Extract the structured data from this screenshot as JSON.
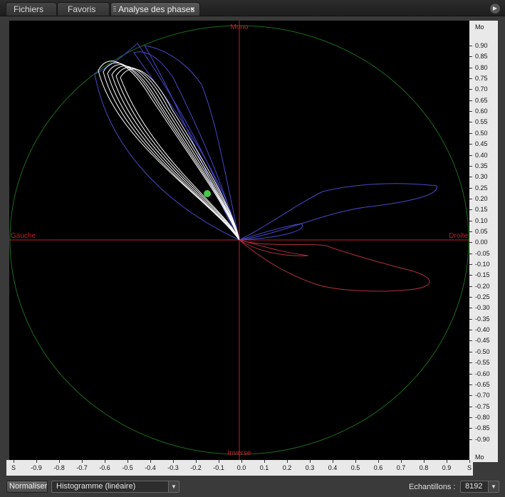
{
  "tabs": [
    {
      "label": "Fichiers"
    },
    {
      "label": "Favoris"
    },
    {
      "label": "Analyse des phases",
      "close": "×"
    }
  ],
  "panel_menu_icon": "play-circle-icon",
  "plot": {
    "top_label": "Mono",
    "bottom_label": "Inverse",
    "left_label": "Gauche",
    "right_label": "Droite",
    "colors": {
      "grid_circle": "#1b6b1b",
      "axes": "#c0202a",
      "left_trace": "#ffffff",
      "left_outer": "#4848c8",
      "right_trace": "#b03040",
      "marker": "#44cc44"
    }
  },
  "right_axis": {
    "top": "Mo",
    "bottom": "Mo",
    "labels": [
      "0.90",
      "0.85",
      "0.80",
      "0.75",
      "0.70",
      "0.65",
      "0.60",
      "0.55",
      "0.50",
      "0.45",
      "0.40",
      "0.35",
      "0.30",
      "0.25",
      "0.20",
      "0.15",
      "0.10",
      "0.05",
      "0.00",
      "-0.05",
      "-0.10",
      "-0.15",
      "-0.20",
      "-0.25",
      "-0.30",
      "-0.35",
      "-0.40",
      "-0.45",
      "-0.50",
      "-0.55",
      "-0.60",
      "-0.65",
      "-0.70",
      "-0.75",
      "-0.80",
      "-0.85",
      "-0.90"
    ]
  },
  "bottom_axis": {
    "labels": [
      "S",
      "-0.9",
      "-0.8",
      "-0.7",
      "-0.6",
      "-0.5",
      "-0.4",
      "-0.3",
      "-0.2",
      "-0.1",
      "0.0",
      "0.1",
      "0.2",
      "0.3",
      "0.4",
      "0.5",
      "0.6",
      "0.7",
      "0.8",
      "0.9",
      "S"
    ]
  },
  "controls": {
    "normalize_label": "Normaliser",
    "mode_value": "Histogramme (linéaire)",
    "samples_label": "Echantillons :",
    "samples_value": "8192",
    "dropdown_icon": "chevron-down-icon"
  }
}
